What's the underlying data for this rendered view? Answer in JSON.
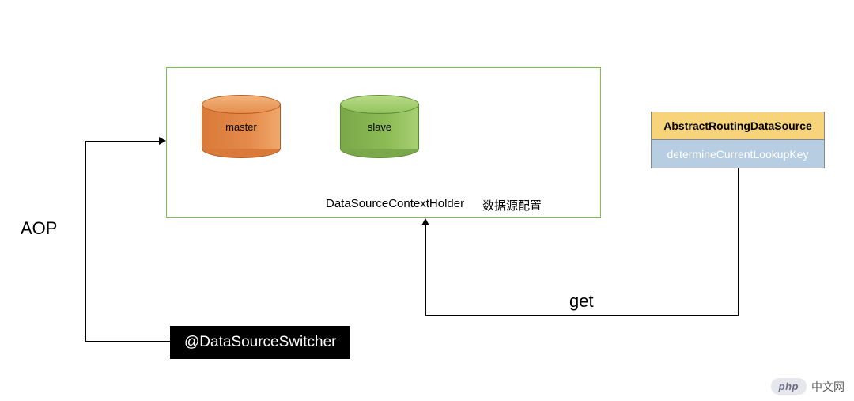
{
  "diagram": {
    "context_holder_caption": "DataSourceContextHolder",
    "context_holder_label": "数据源配置",
    "cylinders": {
      "master_label": "master",
      "slave_label": "slave"
    },
    "routing": {
      "top_label": "AbstractRoutingDataSource",
      "bottom_label": "determineCurrentLookupKey"
    },
    "aop_label": "AOP",
    "get_label": "get",
    "switcher_label": "@DataSourceSwitcher"
  },
  "watermark": {
    "pill": "php",
    "text": "中文网"
  }
}
